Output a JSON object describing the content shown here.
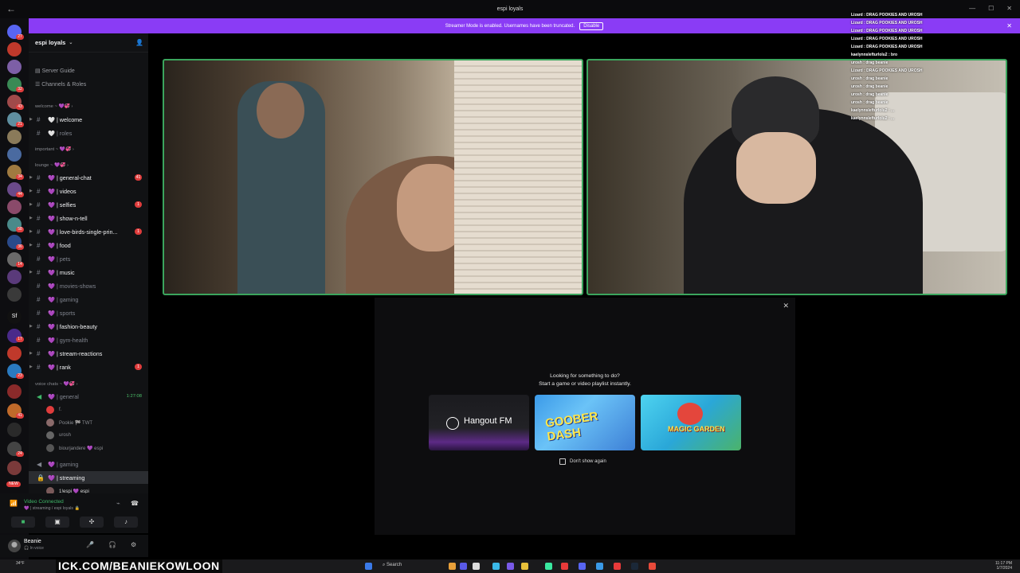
{
  "window": {
    "title": "espi loyals",
    "lock": "🔒"
  },
  "banner": {
    "text": "Streamer Mode is enabled. Usernames have been truncated.",
    "disable_label": "Disable"
  },
  "server": {
    "name": "espi loyals"
  },
  "nav": {
    "server_guide": "Server Guide",
    "channels_roles": "Channels & Roles"
  },
  "categories": {
    "welcome": "welcome ~ 💜💞 ›",
    "important": "important ~ 💜💞 ›",
    "lounge": "lounge ~ 💜💞 ›",
    "voice": "voice chats ~ 💜💞 ›"
  },
  "channels": [
    {
      "label": "🤍 | welcome",
      "muted": false
    },
    {
      "label": "🤍 | roles",
      "muted": true
    },
    {
      "label": "💜 | general-chat",
      "muted": false,
      "badge": "41"
    },
    {
      "label": "💜 | videos",
      "muted": false
    },
    {
      "label": "💜 | selfies",
      "muted": false,
      "badge": "1"
    },
    {
      "label": "💜 | show-n-tell",
      "muted": false
    },
    {
      "label": "💜 | love-birds-single-prin...",
      "muted": false,
      "badge": "1"
    },
    {
      "label": "💜 | food",
      "muted": false
    },
    {
      "label": "💜 | pets",
      "muted": true
    },
    {
      "label": "💜 | music",
      "muted": false
    },
    {
      "label": "💜 | movies-shows",
      "muted": true
    },
    {
      "label": "💜 | gaming",
      "muted": true
    },
    {
      "label": "💜 | sports",
      "muted": true
    },
    {
      "label": "💜 | fashion-beauty",
      "muted": false
    },
    {
      "label": "💜 | gym-health",
      "muted": true
    },
    {
      "label": "💜 | stream-reactions",
      "muted": false
    },
    {
      "label": "💜 | rank",
      "muted": false,
      "badge": "1"
    }
  ],
  "voice": {
    "general_label": "💜 | general",
    "general_timer": "1:27:08",
    "users": [
      "f.",
      "Pookie 🏁 TWT",
      "urosh",
      "biourjandere 💜 espi"
    ],
    "gaming_label": "💜 | gaming",
    "streaming_label": "💜 | streaming",
    "streaming_user": "1!espi 💜 espi"
  },
  "voice_panel": {
    "status": "Video Connected",
    "sub": "💜 | streaming / espi loyals 🔒"
  },
  "user": {
    "name": "Beanie",
    "status": "🎧 In voice"
  },
  "activity": {
    "title_line1": "Looking for something to do?",
    "title_line2": "Start a game or video playlist instantly.",
    "cards": [
      "Hangout FM",
      "GOOBER DASH",
      "MAGIC GARDEN"
    ],
    "dont_show": "Don't show again"
  },
  "chat": [
    "Lizard : DRAG POOKIES AND UROSH",
    "Lizard : DRAG POOKIES AND UROSH",
    "Lizard : DRAG POOKIES AND UROSH",
    "Lizard : DRAG POOKIES AND UROSH",
    "Lizard : DRAG POOKIES AND UROSH",
    "kaelynnslefturlolu2 : bro",
    "urosh : drag beanie",
    "Lizard : DRAG POOKIES AND UROSH",
    "urosh : drag beanie",
    "urosh : drag beanie",
    "urosh : drag beanie",
    "urosh : drag beanie",
    "kaelynnslefturlolu2 : ...",
    "kaelynnslefturlolu2 : ..."
  ],
  "taskbar": {
    "watermark": "ICK.COM/BEANIEKOWLOON",
    "search": "Search",
    "time": "11:17 PM",
    "date": "1/7/2024",
    "weather": "34°F"
  },
  "server_badges": [
    "27",
    "32",
    "43",
    "21",
    "34",
    "44",
    "58",
    "36",
    "14",
    "17",
    "23",
    "41",
    "24",
    "NEW"
  ]
}
